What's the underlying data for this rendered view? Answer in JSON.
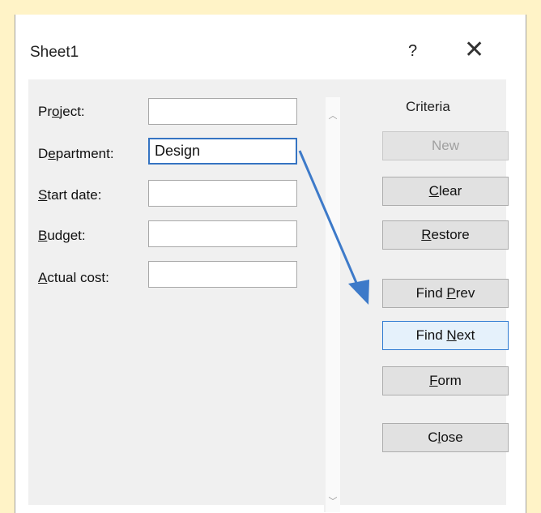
{
  "window": {
    "title": "Sheet1",
    "help": "?",
    "close": "✕"
  },
  "fields": [
    {
      "label_pre": "Pr",
      "label_key": "o",
      "label_post": "ject:",
      "value": ""
    },
    {
      "label_pre": "D",
      "label_key": "e",
      "label_post": "partment:",
      "value": "Design"
    },
    {
      "label_pre": "",
      "label_key": "S",
      "label_post": "tart date:",
      "value": ""
    },
    {
      "label_pre": "",
      "label_key": "B",
      "label_post": "udget:",
      "value": ""
    },
    {
      "label_pre": "",
      "label_key": "A",
      "label_post": "ctual cost:",
      "value": ""
    }
  ],
  "criteria_label": "Criteria",
  "buttons": {
    "new": "New",
    "clear_key": "C",
    "clear_post": "lear",
    "restore_key": "R",
    "restore_post": "estore",
    "findprev_pre": "Find ",
    "findprev_key": "P",
    "findprev_post": "rev",
    "findnext_pre": "Find ",
    "findnext_key": "N",
    "findnext_post": "ext",
    "form_key": "F",
    "form_post": "orm",
    "close_pre": "C",
    "close_key": "l",
    "close_post": "ose"
  },
  "scroll": {
    "up": "︿",
    "down": "﹀"
  },
  "colors": {
    "accent": "#3574c2",
    "arrow": "#3d7ac9",
    "background": "#fff3c7"
  }
}
